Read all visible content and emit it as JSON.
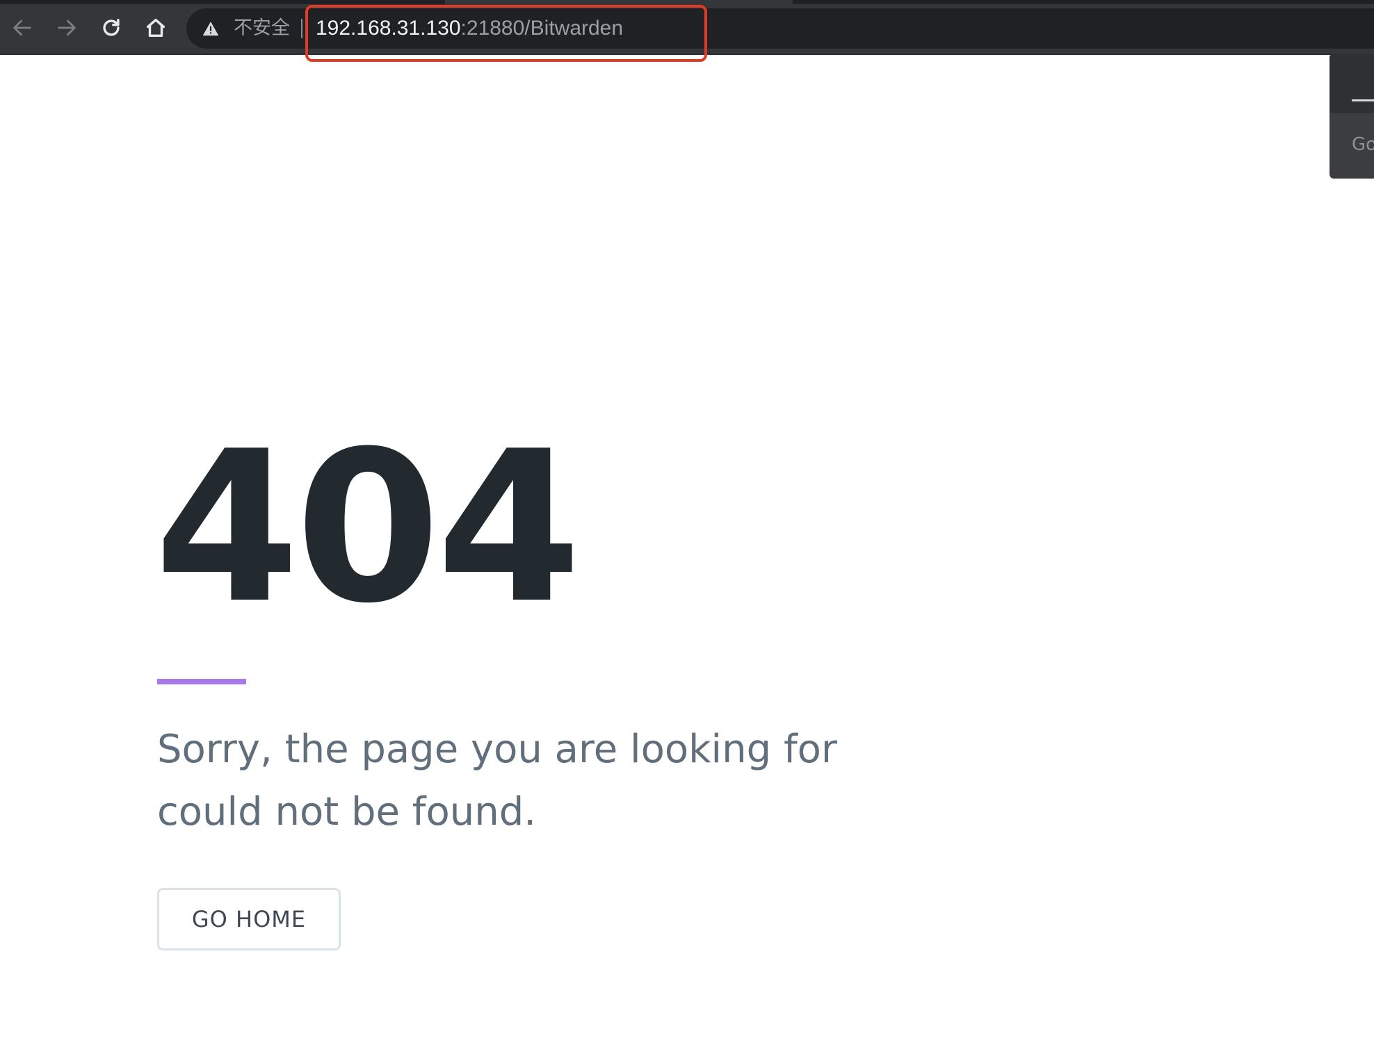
{
  "browser": {
    "security_label": "不安全",
    "url_host": "192.168.31.130",
    "url_rest": ":21880/Bitwarden",
    "side_popup_text": "Go",
    "icons": [
      "back-arrow-icon",
      "forward-arrow-icon",
      "reload-icon",
      "home-icon",
      "warning-icon"
    ]
  },
  "error_page": {
    "code": "404",
    "message": "Sorry, the page you are looking for could not be found.",
    "go_home_label": "GO HOME",
    "accent_color": "#a779e9",
    "text_color": "#606f7b",
    "code_color": "#22292f"
  },
  "annotation": {
    "highlight_color": "#e03b24"
  }
}
